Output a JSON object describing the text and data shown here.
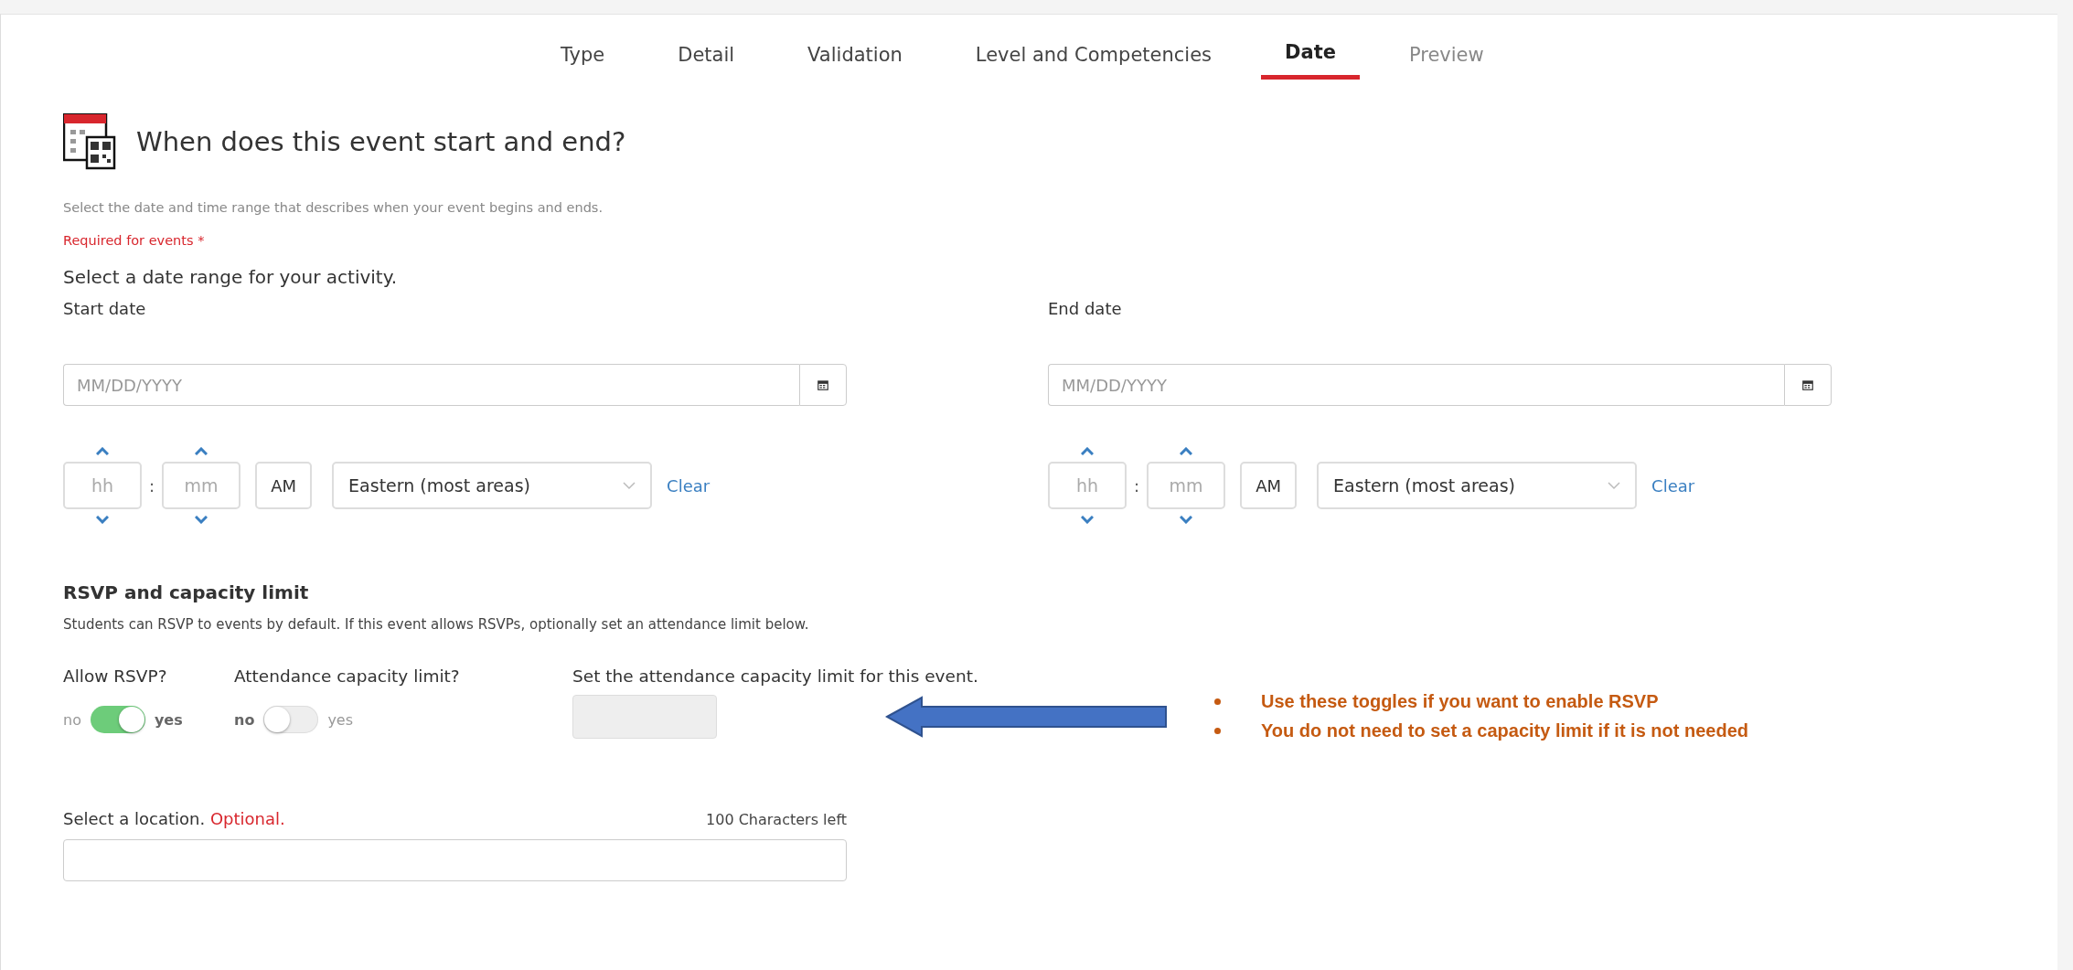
{
  "tabs": [
    {
      "label": "Type",
      "selected": false
    },
    {
      "label": "Detail",
      "selected": false
    },
    {
      "label": "Validation",
      "selected": false
    },
    {
      "label": "Level and Competencies",
      "selected": false
    },
    {
      "label": "Date",
      "selected": true
    },
    {
      "label": "Preview",
      "selected": false
    }
  ],
  "header": {
    "title": "When does this event start and end?",
    "description": "Select the date and time range that describes when your event begins and ends.",
    "required_note": "Required for events *"
  },
  "date_range": {
    "heading": "Select a date range for your activity.",
    "fields": [
      {
        "label": "Start date",
        "placeholder": "MM/DD/YYYY",
        "hour_placeholder": "hh",
        "minute_placeholder": "mm",
        "separator": ":",
        "meridiem": "AM",
        "timezone": "Eastern (most areas)",
        "clear": "Clear"
      },
      {
        "label": "End date",
        "placeholder": "MM/DD/YYYY",
        "hour_placeholder": "hh",
        "minute_placeholder": "mm",
        "separator": ":",
        "meridiem": "AM",
        "timezone": "Eastern (most areas)",
        "clear": "Clear"
      }
    ]
  },
  "rsvp": {
    "heading": "RSVP and capacity limit",
    "description": "Students can RSVP to events by default. If this event allows RSVPs, optionally set an attendance limit below.",
    "toggles": [
      {
        "label": "Allow RSVP?",
        "off_label": "no",
        "on_label": "yes",
        "on": true
      },
      {
        "label": "Attendance capacity limit?",
        "off_label": "no",
        "on_label": "yes",
        "on": false
      }
    ],
    "capacity": {
      "label": "Set the attendance capacity limit for this event."
    }
  },
  "location": {
    "label": "Select a location.",
    "optional": "Optional.",
    "counter": "100 Characters left"
  },
  "annotation": {
    "notes": [
      "Use these toggles if you want to enable RSVP",
      "You do not need to set a capacity limit if it is not needed"
    ]
  }
}
